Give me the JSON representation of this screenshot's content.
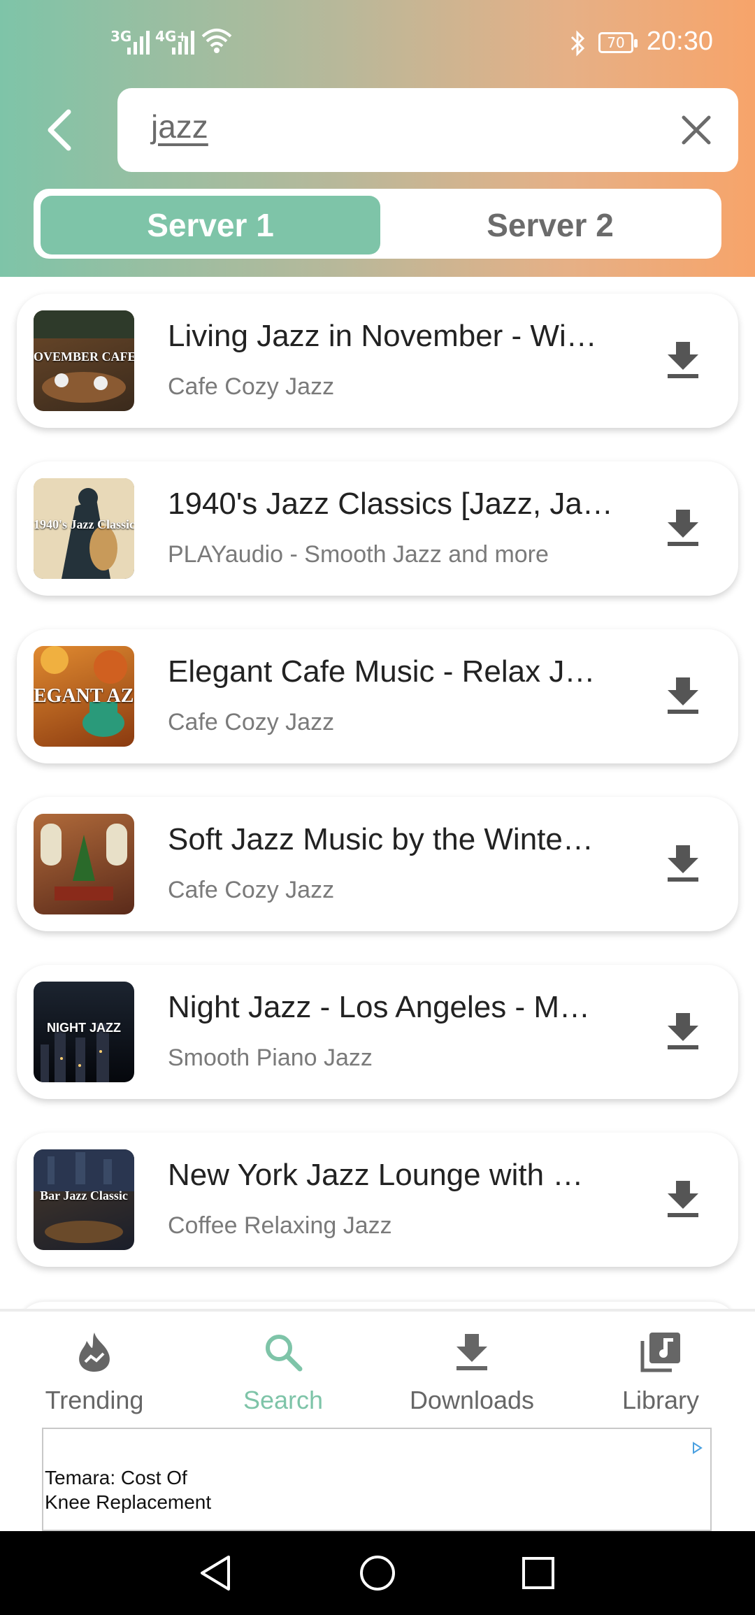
{
  "status_bar": {
    "signal_1": "3G",
    "signal_2": "4G+",
    "battery": "70",
    "time": "20:30"
  },
  "search": {
    "query": "jazz"
  },
  "server_toggle": {
    "server1_label": "Server 1",
    "server2_label": "Server 2",
    "selected": "Server 1"
  },
  "results": [
    {
      "title": "Living Jazz in November - Wi…",
      "channel": "Cafe Cozy Jazz",
      "thumb_text": "OVEMBER CAFE JA",
      "thumb_colors": [
        "#3a2a1c",
        "#6e4a2a"
      ]
    },
    {
      "title": "1940's Jazz Classics [Jazz, Ja…",
      "channel": "PLAYaudio - Smooth Jazz and more",
      "thumb_text": "1940's Jazz Classic",
      "thumb_colors": [
        "#2a3a3c",
        "#c8b48a"
      ]
    },
    {
      "title": "Elegant Cafe Music - Relax J…",
      "channel": "Cafe Cozy Jazz",
      "thumb_text": "EGANT AZZ",
      "thumb_colors": [
        "#8a3a10",
        "#e08a30"
      ]
    },
    {
      "title": "Soft Jazz Music by the Winte…",
      "channel": "Cafe Cozy Jazz",
      "thumb_text": "",
      "thumb_colors": [
        "#5a2a1a",
        "#b06a3a"
      ]
    },
    {
      "title": "Night Jazz - Los Angeles - M…",
      "channel": "Smooth Piano Jazz",
      "thumb_text": "NIGHT JAZZ",
      "thumb_colors": [
        "#05070c",
        "#1c2430"
      ]
    },
    {
      "title": "New York Jazz Lounge with …",
      "channel": "Coffee Relaxing Jazz",
      "thumb_text": "Bar Jazz Classic",
      "thumb_colors": [
        "#1a1e2a",
        "#4a3a2a"
      ]
    }
  ],
  "nav": {
    "trending": "Trending",
    "search": "Search",
    "downloads": "Downloads",
    "library": "Library",
    "active": "Search"
  },
  "ad": {
    "text": "Temara: Cost Of Knee Replacement"
  },
  "colors": {
    "accent": "#7ec4a8",
    "header_gradient_end": "#f7a46a"
  }
}
